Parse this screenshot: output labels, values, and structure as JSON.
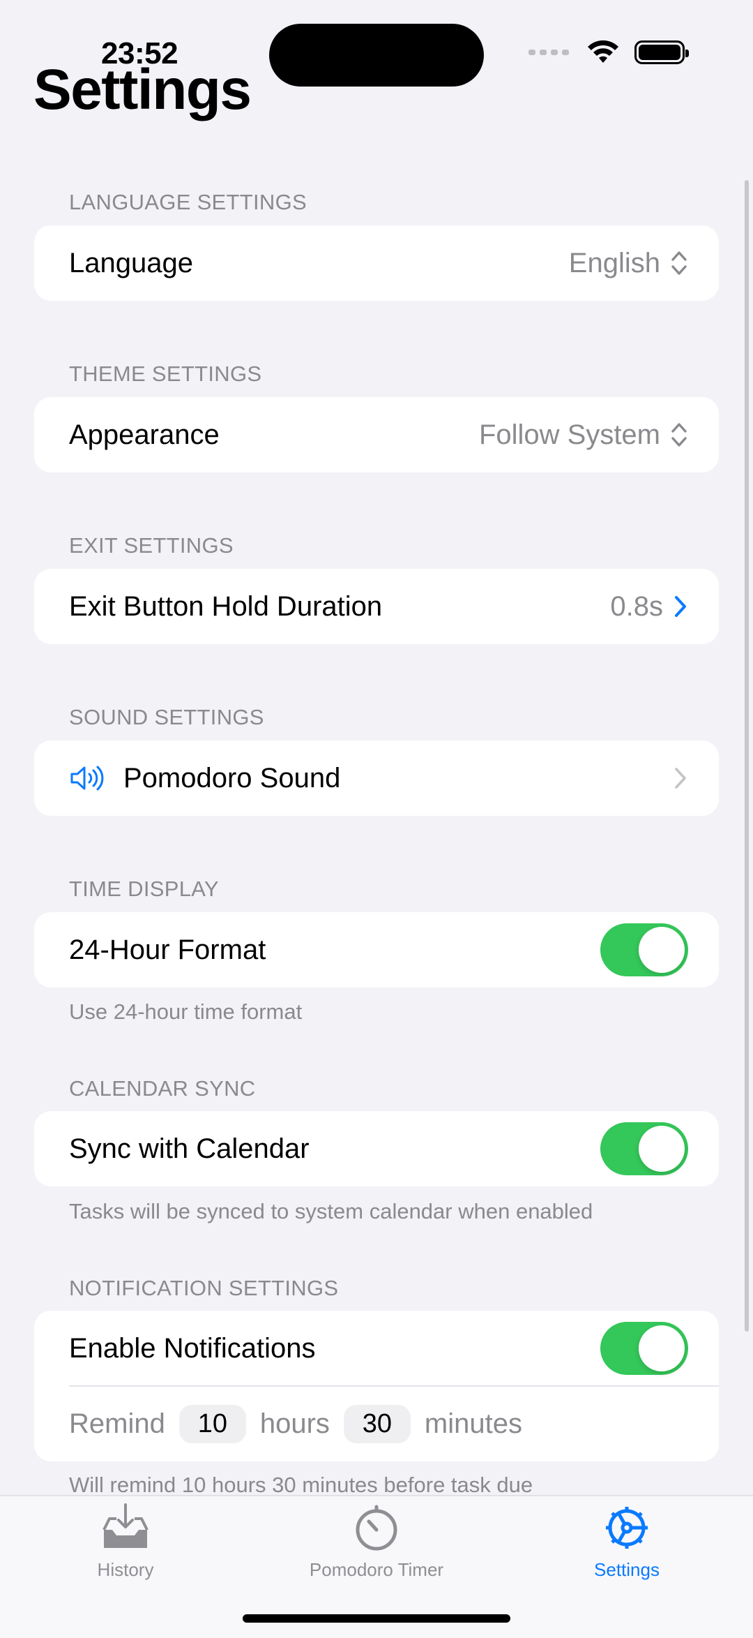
{
  "status_bar": {
    "time": "23:52"
  },
  "title": "Settings",
  "sections": {
    "language": {
      "header": "LANGUAGE SETTINGS",
      "label": "Language",
      "value": "English"
    },
    "theme": {
      "header": "THEME SETTINGS",
      "label": "Appearance",
      "value": "Follow System"
    },
    "exit": {
      "header": "EXIT SETTINGS",
      "label": "Exit Button Hold Duration",
      "value": "0.8s"
    },
    "sound": {
      "header": "SOUND SETTINGS",
      "label": "Pomodoro Sound",
      "icon": "speaker-icon"
    },
    "time_display": {
      "header": "TIME DISPLAY",
      "label": "24-Hour Format",
      "enabled": true,
      "footer": "Use 24-hour time format"
    },
    "calendar": {
      "header": "CALENDAR SYNC",
      "label": "Sync with Calendar",
      "enabled": true,
      "footer": "Tasks will be synced to system calendar when enabled"
    },
    "notifications": {
      "header": "NOTIFICATION SETTINGS",
      "label": "Enable Notifications",
      "enabled": true,
      "remind_prefix": "Remind",
      "hours_value": "10",
      "hours_label": "hours",
      "minutes_value": "30",
      "minutes_label": "minutes",
      "footer": "Will remind 10 hours 30 minutes before task due"
    }
  },
  "tabbar": {
    "tabs": [
      {
        "label": "History",
        "icon": "tray-icon",
        "active": false
      },
      {
        "label": "Pomodoro Timer",
        "icon": "timer-icon",
        "active": false
      },
      {
        "label": "Settings",
        "icon": "gear-icon",
        "active": true
      }
    ]
  },
  "colors": {
    "accent": "#0A7AFF",
    "toggle_on": "#34C759",
    "background": "#F2F2F7",
    "secondary_text": "#8A8A8E"
  }
}
